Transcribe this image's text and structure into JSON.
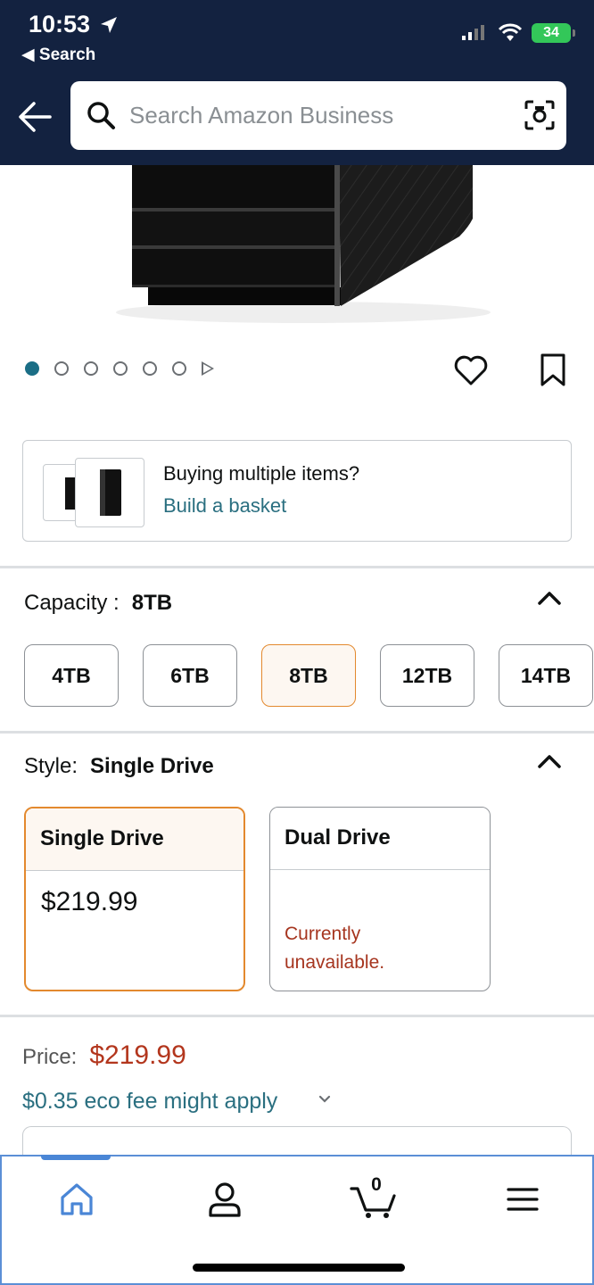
{
  "status_bar": {
    "time": "10:53",
    "back_app": "◀ Search",
    "battery": "34"
  },
  "search": {
    "placeholder": "Search Amazon Business"
  },
  "carousel": {
    "count": 6,
    "active_index": 0
  },
  "basket": {
    "question": "Buying multiple items?",
    "link": "Build a basket"
  },
  "capacity": {
    "label": "Capacity :",
    "selected": "8TB",
    "options": [
      {
        "label": "4TB",
        "selected": false
      },
      {
        "label": "6TB",
        "selected": false
      },
      {
        "label": "8TB",
        "selected": true
      },
      {
        "label": "12TB",
        "selected": false
      },
      {
        "label": "14TB",
        "selected": false
      }
    ]
  },
  "style": {
    "label": "Style:",
    "selected": "Single Drive",
    "options": [
      {
        "name": "Single Drive",
        "price": "$219.99",
        "status": "",
        "selected": true
      },
      {
        "name": "Dual Drive",
        "price": "",
        "status": "Currently unavailable.",
        "selected": false
      }
    ]
  },
  "price": {
    "label": "Price:",
    "value": "$219.99",
    "eco_fee": "$0.35 eco fee might apply"
  },
  "bottom_nav": {
    "cart_count": "0",
    "items": [
      "home-icon",
      "account-icon",
      "cart-icon",
      "menu-icon"
    ]
  },
  "colors": {
    "header_bg": "#132240",
    "accent_orange": "#e3892e",
    "link_teal": "#2a6f80",
    "price_red": "#b3361d"
  }
}
